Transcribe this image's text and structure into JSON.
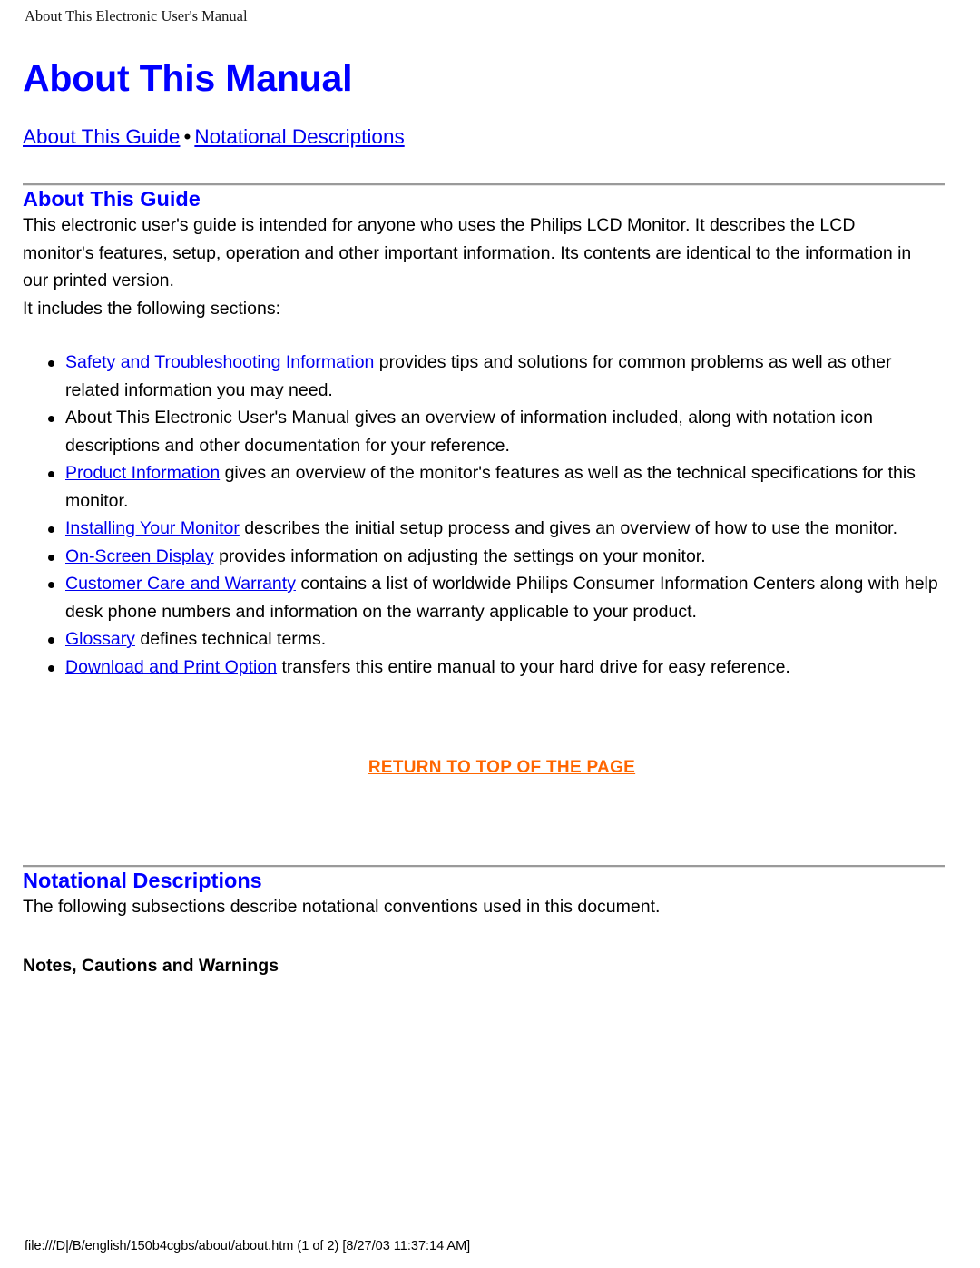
{
  "page": {
    "running_head": "About This Electronic User's Manual",
    "footer": "file:///D|/B/english/150b4cgbs/about/about.htm (1 of 2) [8/27/03 11:37:14 AM]"
  },
  "colors": {
    "heading_blue": "#0000FF",
    "link_blue": "#0000EE",
    "return_top_orange": "#FF6600",
    "rule_gray": "#9A9A9A",
    "background": "#FFFFFF"
  },
  "document": {
    "title": "About This Manual",
    "nav": {
      "separator": "•",
      "links": [
        {
          "label": "About This Guide"
        },
        {
          "label": "Notational Descriptions"
        }
      ]
    },
    "sections": [
      {
        "id": "about-this-guide",
        "heading": "About This Guide",
        "intro_paragraph": "This electronic user's guide is intended for anyone who uses the Philips LCD Monitor. It describes the LCD monitor's features, setup, operation and other important information. Its contents are identical to the information in our printed version.",
        "includes_paragraph": "It includes the following sections:",
        "list": [
          {
            "link": "Safety and Troubleshooting Information",
            "text": " provides tips and solutions for common problems as well as other related information you may need."
          },
          {
            "link": "",
            "text": "About This Electronic User's Manual gives an overview of information included, along with notation icon descriptions and other documentation for your reference."
          },
          {
            "link": "Product Information",
            "text": " gives an overview of the monitor's features as well as the technical specifications for this monitor."
          },
          {
            "link": "Installing Your Monitor",
            "text": " describes the initial setup process and gives an overview of how to use the monitor."
          },
          {
            "link": "On-Screen Display",
            "text": " provides information on adjusting the settings on your monitor."
          },
          {
            "link": "Customer Care and Warranty",
            "text": " contains a list of worldwide Philips Consumer Information Centers along with help desk phone numbers and information on the warranty applicable to your product."
          },
          {
            "link": "Glossary",
            "text": " defines technical terms."
          },
          {
            "link": "Download and Print Option",
            "text": " transfers this entire manual to your hard drive for easy reference."
          }
        ],
        "return_to_top": "RETURN TO TOP OF THE PAGE"
      },
      {
        "id": "notational-descriptions",
        "heading": "Notational Descriptions",
        "intro_paragraph": "The following subsections describe notational conventions used in this document.",
        "subheading": "Notes, Cautions and Warnings"
      }
    ]
  }
}
